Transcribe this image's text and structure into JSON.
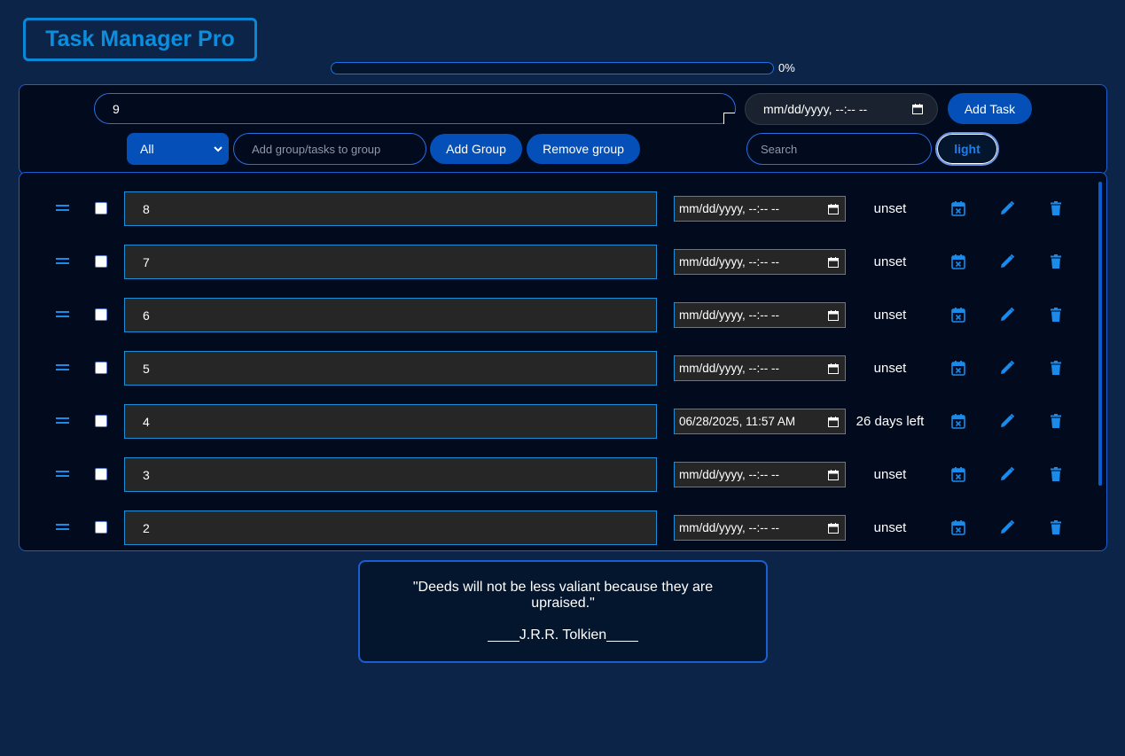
{
  "app": {
    "title": "Task Manager Pro"
  },
  "progress": {
    "percent": 0,
    "label": "0%"
  },
  "controls": {
    "task_input_value": "9",
    "deadline_placeholder": "mm/dd/yyyy, --:-- --",
    "add_task_label": "Add Task",
    "group_select_value": "All",
    "group_input_placeholder": "Add group/tasks to group",
    "add_group_label": "Add Group",
    "remove_group_label": "Remove group",
    "search_placeholder": "Search",
    "theme_toggle_label": "light"
  },
  "tasks": [
    {
      "name": "8",
      "date": "mm/dd/yyyy, --:-- --",
      "status": "unset"
    },
    {
      "name": "7",
      "date": "mm/dd/yyyy, --:-- --",
      "status": "unset"
    },
    {
      "name": "6",
      "date": "mm/dd/yyyy, --:-- --",
      "status": "unset"
    },
    {
      "name": "5",
      "date": "mm/dd/yyyy, --:-- --",
      "status": "unset"
    },
    {
      "name": "4",
      "date": "06/28/2025, 11:57 AM",
      "status": "26 days left"
    },
    {
      "name": "3",
      "date": "mm/dd/yyyy, --:-- --",
      "status": "unset"
    },
    {
      "name": "2",
      "date": "mm/dd/yyyy, --:-- --",
      "status": "unset"
    }
  ],
  "icons": {
    "drag": "drag-handle-icon",
    "calendar": "calendar-icon",
    "clear_date": "calendar-x-icon",
    "edit": "pencil-icon",
    "delete": "trash-icon"
  },
  "quote": {
    "text": "\"Deeds will not be less valiant because they are upraised.\"",
    "author": "____J.R.R. Tolkien____"
  },
  "colors": {
    "background": "#0b2447",
    "panel": "#020a1e",
    "accent": "#0550b8",
    "icon": "#1c8ae8",
    "border": "#1b5ed0"
  }
}
